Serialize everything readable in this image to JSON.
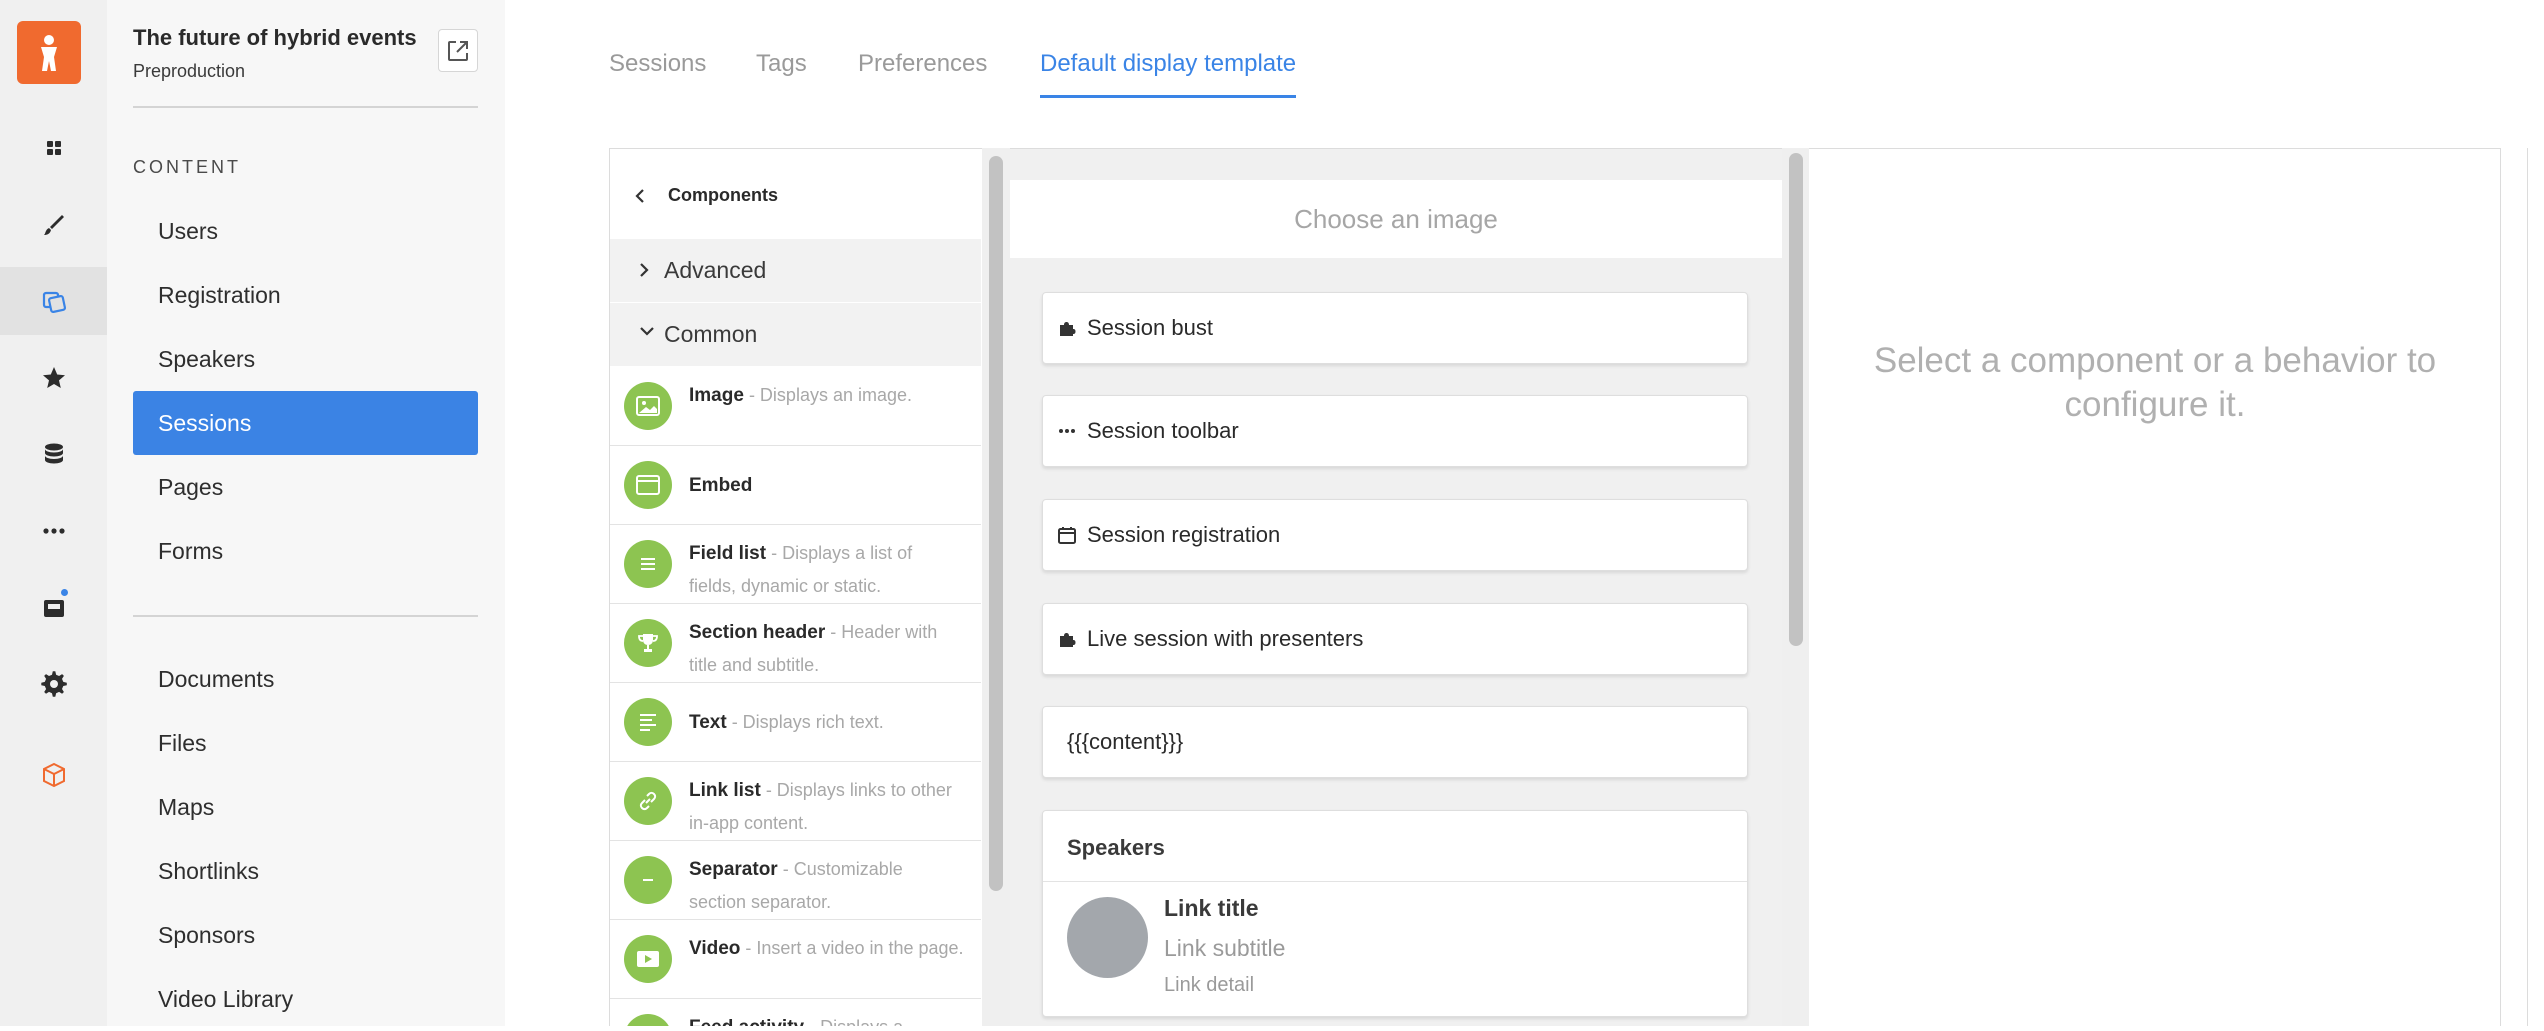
{
  "rail": {
    "logo": "person-logo-icon",
    "items": [
      "dashboard-icon",
      "brush-icon",
      "content-icon",
      "star-icon",
      "database-icon",
      "more-icon",
      "inbox-icon",
      "settings-icon",
      "package-icon"
    ]
  },
  "project": {
    "title": "The future of hybrid events",
    "subtitle": "Preproduction"
  },
  "sidebar": {
    "section_label": "CONTENT",
    "content_items": [
      "Users",
      "Registration",
      "Speakers",
      "Sessions",
      "Pages",
      "Forms"
    ],
    "other_items": [
      "Documents",
      "Files",
      "Maps",
      "Shortlinks",
      "Sponsors",
      "Video Library"
    ],
    "active_item": "Sessions"
  },
  "tabs": {
    "items": [
      "Sessions",
      "Tags",
      "Preferences",
      "Default display template"
    ],
    "active": "Default display template"
  },
  "components": {
    "header": "Components",
    "groups": [
      "Advanced",
      "Common"
    ],
    "items": [
      {
        "name": "Image",
        "desc": "- Displays an image."
      },
      {
        "name": "Embed",
        "desc": ""
      },
      {
        "name": "Field list",
        "desc": "- Displays a list of fields, dynamic or static."
      },
      {
        "name": "Section header",
        "desc": "- Header with title and subtitle."
      },
      {
        "name": "Text",
        "desc": "- Displays rich text."
      },
      {
        "name": "Link list",
        "desc": "- Displays links to other in-app content."
      },
      {
        "name": "Separator",
        "desc": "- Customizable section separator."
      },
      {
        "name": "Video",
        "desc": "- Insert a video in the page."
      },
      {
        "name": "Feed activity",
        "desc": "- Displays a"
      }
    ]
  },
  "canvas": {
    "image_placeholder": "Choose an image",
    "blocks": [
      "Session bust",
      "Session toolbar",
      "Session registration",
      "Live session with presenters",
      "{{{content}}}"
    ],
    "speakers": {
      "heading": "Speakers",
      "link_title": "Link title",
      "link_subtitle": "Link subtitle",
      "link_detail": "Link detail"
    }
  },
  "config": {
    "message": "Select a component or a behavior to configure it."
  },
  "colors": {
    "accent": "#3b83e4",
    "brand": "#f06a2f",
    "component_icon": "#8dc451"
  }
}
